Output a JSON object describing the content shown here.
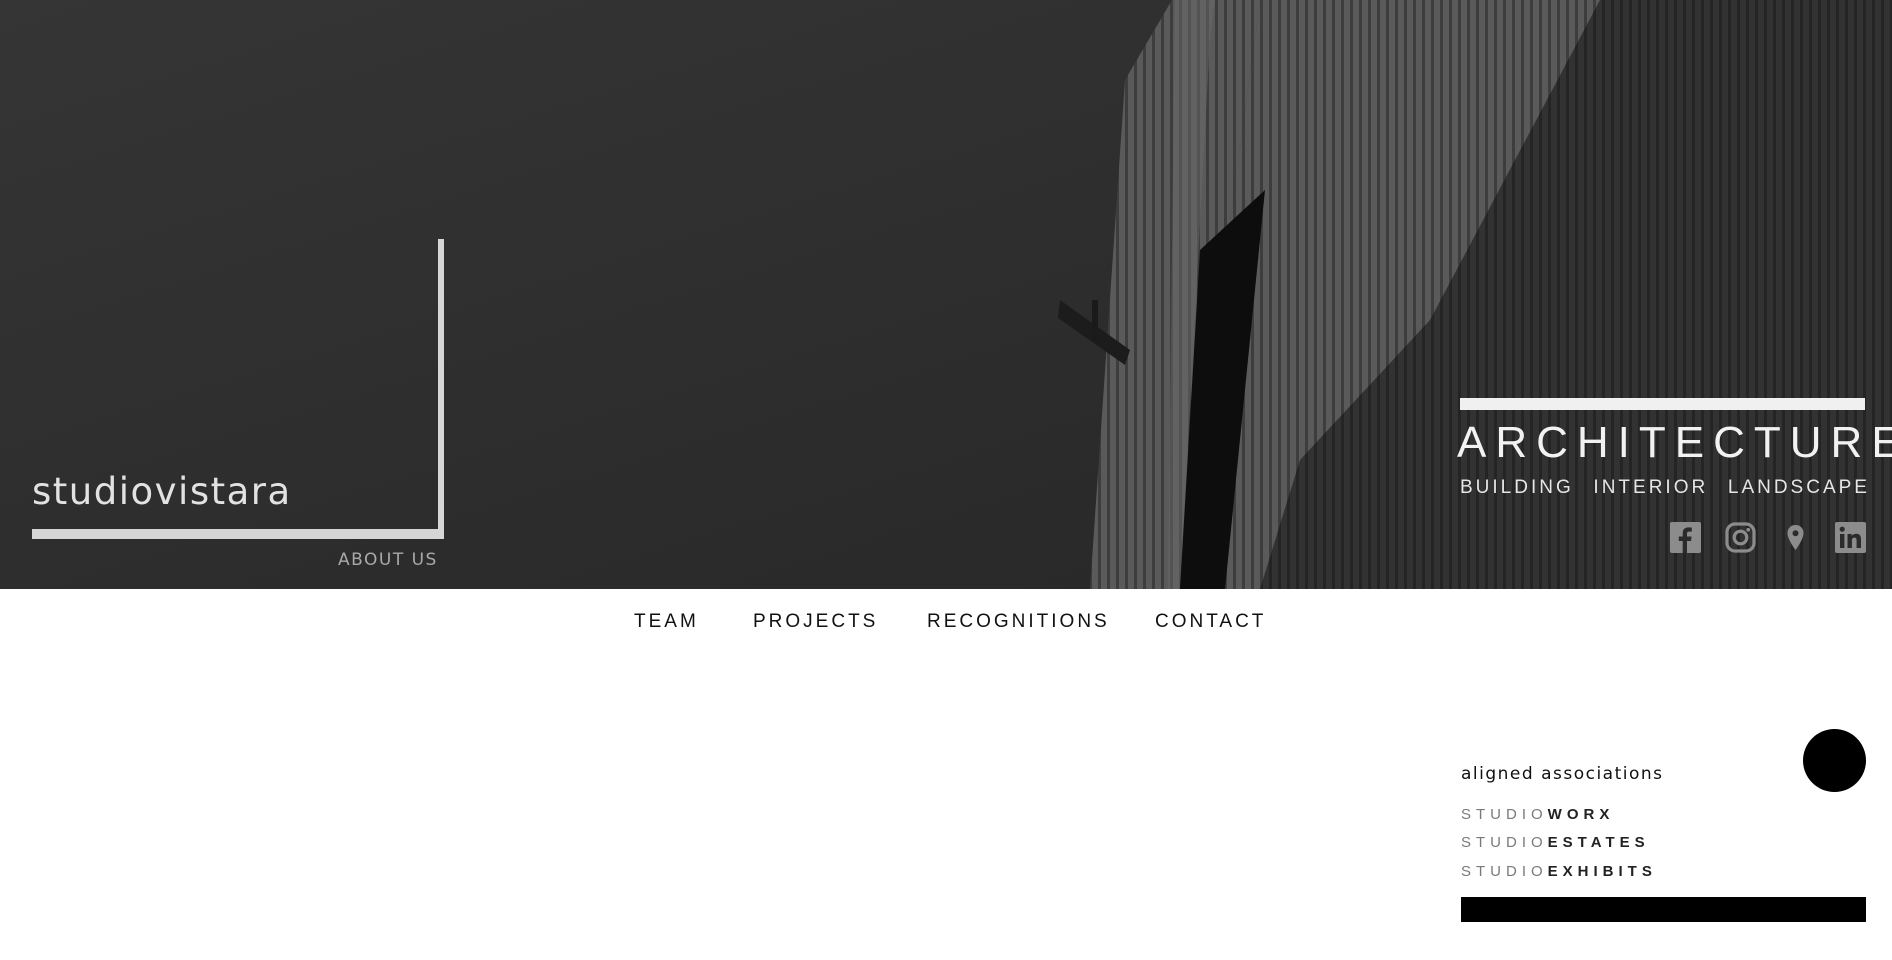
{
  "brand": {
    "name": "studiovistara",
    "about_label": "ABOUT US"
  },
  "hero": {
    "title": "ARCHITECTURE",
    "subtitles": [
      "BUILDING",
      "INTERIOR",
      "LANDSCAPE"
    ],
    "social_icons": [
      "facebook-icon",
      "instagram-icon",
      "location-pin-icon",
      "linkedin-icon"
    ]
  },
  "nav": {
    "items": [
      "TEAM",
      "PROJECTS",
      "RECOGNITIONS",
      "CONTACT"
    ]
  },
  "associations": {
    "title": "aligned associations",
    "links": [
      {
        "prefix": "STUDIO",
        "suffix": "WORX"
      },
      {
        "prefix": "STUDIO",
        "suffix": "ESTATES"
      },
      {
        "prefix": "STUDIO",
        "suffix": "EXHIBITS"
      }
    ]
  },
  "colors": {
    "hero_bg": "#2e2e2e",
    "accent": "#000000",
    "frame": "#d6d6d6"
  }
}
